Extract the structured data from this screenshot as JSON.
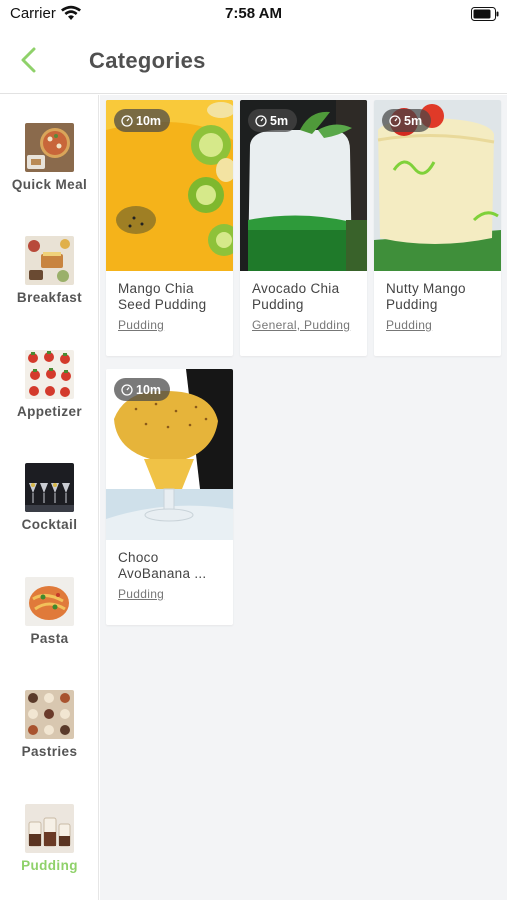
{
  "status_bar": {
    "carrier": "Carrier",
    "time": "7:58 AM"
  },
  "nav": {
    "title": "Categories"
  },
  "sidebar": {
    "items": [
      {
        "label": "Quick Meal",
        "active": false
      },
      {
        "label": "Breakfast",
        "active": false
      },
      {
        "label": "Appetizer",
        "active": false
      },
      {
        "label": "Cocktail",
        "active": false
      },
      {
        "label": "Pasta",
        "active": false
      },
      {
        "label": "Pastries",
        "active": false
      },
      {
        "label": "Pudding",
        "active": true
      }
    ]
  },
  "recipes": [
    {
      "time": "10m",
      "title": "Mango Chia Seed Pudding",
      "category": "Pudding"
    },
    {
      "time": "5m",
      "title": "Avocado Chia Pudding",
      "category": "General, Pudding"
    },
    {
      "time": "5m",
      "title": "Nutty Mango Pudding",
      "category": "Pudding"
    },
    {
      "time": "10m",
      "title": "Choco AvoBanana ...",
      "category": "Pudding"
    }
  ],
  "colors": {
    "accent": "#8fd16a",
    "badge_bg": "#464646",
    "content_bg": "#f3f4f6"
  }
}
